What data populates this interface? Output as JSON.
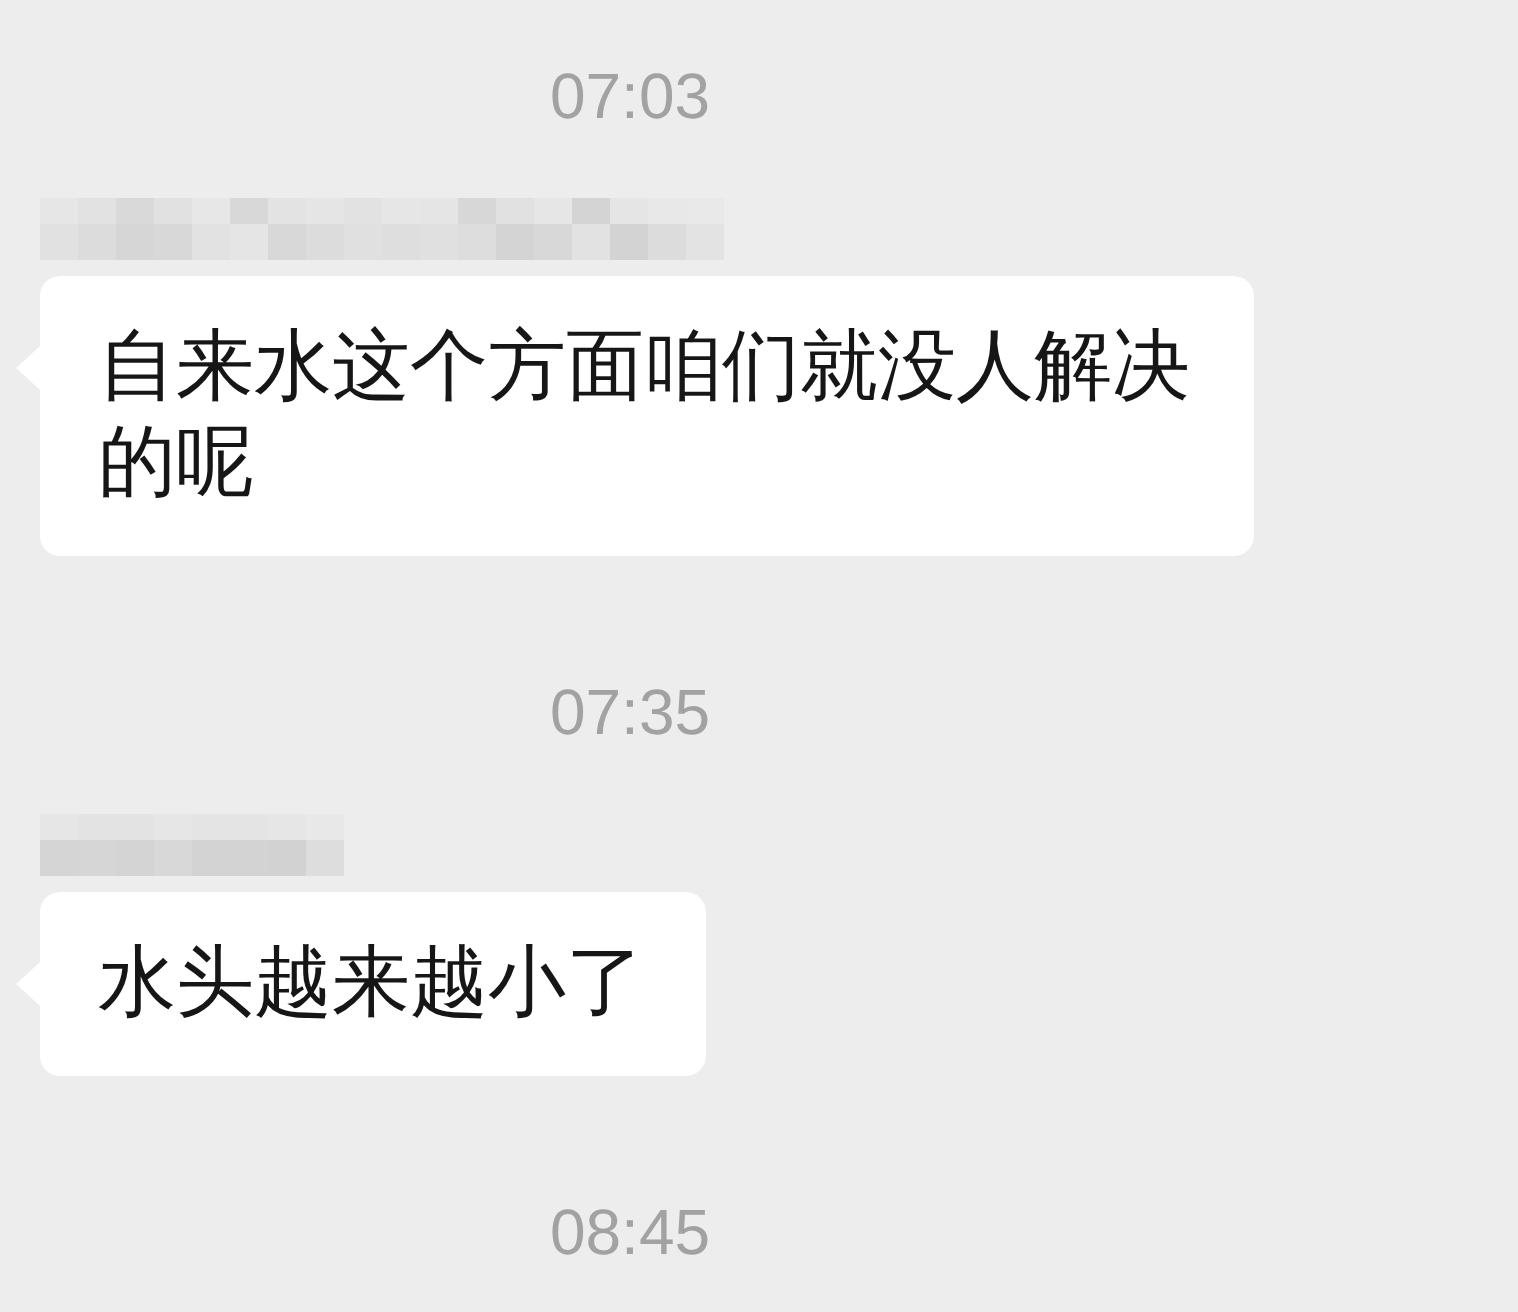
{
  "chat": [
    {
      "kind": "time",
      "text": "07:03"
    },
    {
      "kind": "message",
      "sender_pixelated": true,
      "text": "自来水这个方面咱们就没人解决的呢"
    },
    {
      "kind": "time",
      "text": "07:35"
    },
    {
      "kind": "message",
      "sender_pixelated": true,
      "text": "水头越来越小了"
    },
    {
      "kind": "time",
      "text": "08:45"
    }
  ]
}
